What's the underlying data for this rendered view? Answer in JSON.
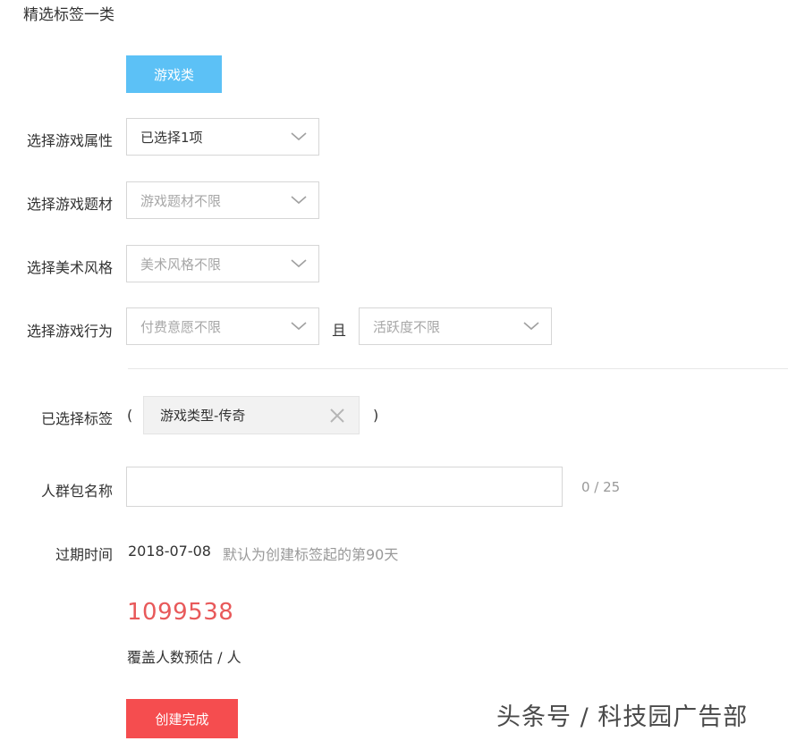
{
  "header": {
    "title": "精选标签一类"
  },
  "category_tab": {
    "label": "游戏类"
  },
  "filters": {
    "attribute": {
      "label": "选择游戏属性",
      "value": "已选择1项"
    },
    "theme": {
      "label": "选择游戏题材",
      "value": "游戏题材不限"
    },
    "art_style": {
      "label": "选择美术风格",
      "value": "美术风格不限"
    },
    "behavior": {
      "label": "选择游戏行为",
      "pay_value": "付费意愿不限",
      "and_label": "且",
      "activity_value": "活跃度不限"
    }
  },
  "selected_tags": {
    "label": "已选择标签",
    "open_paren": "(",
    "close_paren": ")",
    "tags": [
      {
        "text": "游戏类型-传奇"
      }
    ]
  },
  "audience_name": {
    "label": "人群包名称",
    "value": "",
    "placeholder": "",
    "counter": "0 / 25"
  },
  "expiry": {
    "label": "过期时间",
    "date": "2018-07-08",
    "note": "默认为创建标签起的第90天"
  },
  "coverage": {
    "count": "1099538",
    "label": "覆盖人数预估 / 人"
  },
  "actions": {
    "create_label": "创建完成"
  },
  "watermark": {
    "text": "头条号 / 科技园广告部"
  },
  "colors": {
    "accent_blue": "#5cc1f6",
    "accent_red": "#f54d4f",
    "count_red": "#e8595a"
  }
}
